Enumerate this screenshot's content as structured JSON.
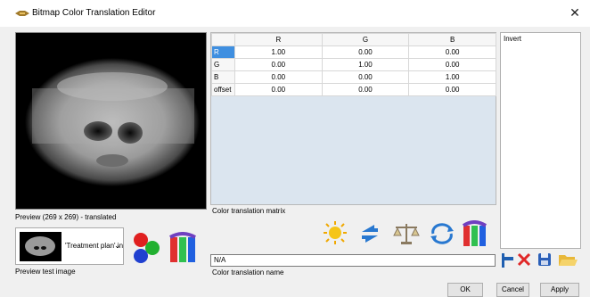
{
  "window": {
    "title": "Bitmap Color Translation Editor"
  },
  "preview": {
    "caption": "Preview (269 x 269) - translated",
    "test_image_caption": "Preview test image",
    "test_image_selector": "'Treatment plan' in"
  },
  "matrix": {
    "columns": [
      "R",
      "G",
      "B"
    ],
    "rows": [
      {
        "label": "R",
        "values": [
          "1.00",
          "0.00",
          "0.00"
        ]
      },
      {
        "label": "G",
        "values": [
          "0.00",
          "1.00",
          "0.00"
        ]
      },
      {
        "label": "B",
        "values": [
          "0.00",
          "0.00",
          "1.00"
        ]
      },
      {
        "label": "offset",
        "values": [
          "0.00",
          "0.00",
          "0.00"
        ]
      }
    ],
    "caption": "Color translation matrix"
  },
  "list": {
    "items": [
      "Invert"
    ]
  },
  "name": {
    "value": "N/A",
    "caption": "Color translation name"
  },
  "buttons": {
    "ok": "OK",
    "cancel": "Cancel",
    "apply": "Apply"
  },
  "icons": {
    "title": "palette-icon",
    "close": "close-icon",
    "rgb_balls": "rgb-balls-icon",
    "color_channels": "color-channels-icon",
    "brightness": "sun-icon",
    "swap": "swap-arrows-icon",
    "balance": "balance-scale-icon",
    "cycle": "cycle-arrows-icon",
    "channels2": "color-channels-icon",
    "new": "flag-icon",
    "delete": "delete-x-icon",
    "save": "save-disk-icon",
    "open": "open-folder-icon"
  },
  "colors": {
    "selection": "#3f8fe0",
    "panel_bg": "#dbe5ef"
  }
}
